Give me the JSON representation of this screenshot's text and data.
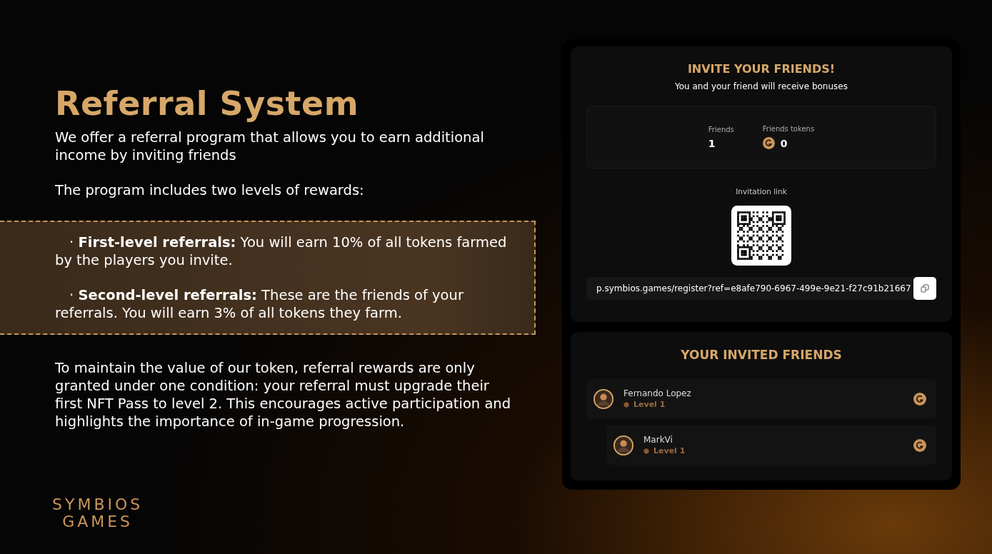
{
  "intro": {
    "title": "Referral System",
    "paragraphs": [
      "We offer a referral program that allows you to earn additional income by inviting friends",
      "The program includes two levels of rewards:"
    ]
  },
  "reward_levels": [
    "· **First-level referrals:** You will earn 10% of all tokens farmed by the players you invite.",
    "· **Second-level referrals:** These are the friends of your referrals. You will earn 3% of all tokens they farm."
  ],
  "condition": "To maintain the value of our token, referral rewards are only granted under one condition: your referral must upgrade their first NFT Pass to level 2. This encourages active participation and highlights the importance of in-game progression.",
  "logo": [
    "SYMBIOS",
    "GAMES"
  ],
  "invite_panel": {
    "title": "INVITE YOUR FRIENDS!",
    "subtitle": "You and your friend will receive bonuses",
    "stats": [
      {
        "label": "Friends",
        "value": "1",
        "kind": "plain"
      },
      {
        "label": "Friends tokens",
        "value": "0",
        "kind": "token"
      }
    ],
    "link_label": "Invitation link",
    "link": "p.symbios.games/register?ref=e8afe790-6967-499e-9e21-f27c91b21667"
  },
  "friends_panel": {
    "title": "YOUR INVITED FRIENDS",
    "friends": [
      {
        "name": "Fernando Lopez",
        "level": "Level 1",
        "children": [
          {
            "name": "MarkVi",
            "level": "Level 1"
          }
        ]
      }
    ]
  }
}
